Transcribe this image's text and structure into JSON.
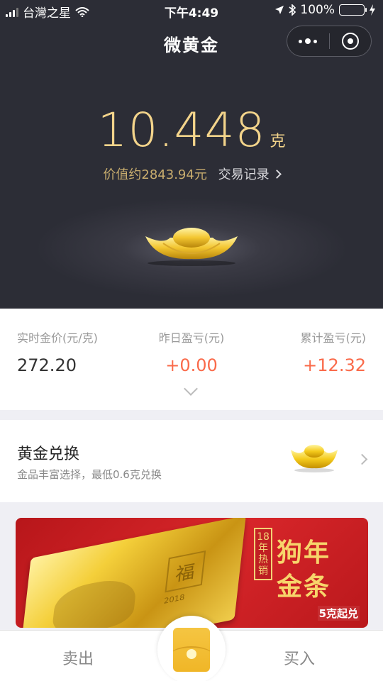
{
  "status_bar": {
    "carrier": "台灣之星",
    "time": "下午4:49",
    "battery": "100%"
  },
  "nav": {
    "title": "微黄金"
  },
  "holding": {
    "weight": "10.448",
    "unit": "克",
    "value": "价值约2843.94元",
    "records_link": "交易记录"
  },
  "stats": {
    "price_label": "实时金价(元/克)",
    "price_value": "272.20",
    "yesterday_label": "昨日盈亏(元)",
    "yesterday_value": "+0.00",
    "total_label": "累计盈亏(元)",
    "total_value": "+12.32"
  },
  "exchange": {
    "title": "黄金兑换",
    "subtitle": "金品丰富选择，最低0.6克兑换"
  },
  "banner": {
    "stamp": "18年热销",
    "title_line1": "狗年",
    "title_line2": "金条",
    "slogan": "5克起兑",
    "bar_year": "2018"
  },
  "tabbar": {
    "sell": "卖出",
    "buy": "买入"
  },
  "colors": {
    "header_bg": "#2d2e37",
    "gold_text": "#f3d48b",
    "profit": "#fa6a4a",
    "banner_red": "#d8262a"
  }
}
